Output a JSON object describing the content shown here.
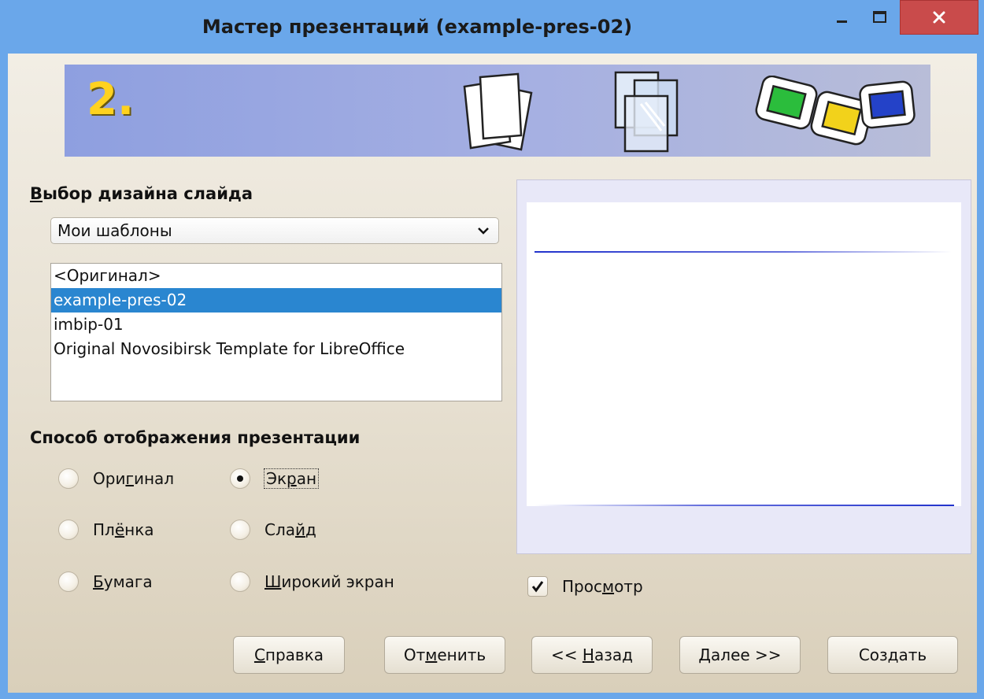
{
  "window": {
    "title": "Мастер презентаций (example-pres-02)"
  },
  "banner": {
    "step_number": "2."
  },
  "slide_design": {
    "heading_first": "В",
    "heading_rest": "ыбор дизайна слайда",
    "category_value": "Мои шаблоны",
    "templates": [
      {
        "label": "<Оригинал>",
        "selected": false
      },
      {
        "label": "example-pres-02",
        "selected": true
      },
      {
        "label": "imbip-01",
        "selected": false
      },
      {
        "label": "Original Novosibirsk Template for LibreOffice",
        "selected": false
      }
    ]
  },
  "output_medium": {
    "heading": "Способ отображения презентации",
    "options": {
      "original": {
        "pre": "Ори",
        "u": "г",
        "post": "инал"
      },
      "screen": {
        "pre": "Эк",
        "u": "р",
        "post": "ан"
      },
      "film": {
        "pre": "Пл",
        "u": "ё",
        "post": "нка"
      },
      "slide": {
        "pre": "Сла",
        "u": "й",
        "post": "д"
      },
      "paper": {
        "pre": "",
        "u": "Б",
        "post": "умага"
      },
      "widescreen": {
        "pre": "",
        "u": "Ш",
        "post": "ирокий экран"
      }
    },
    "selected": "screen"
  },
  "preview": {
    "checkbox": {
      "pre": "Прос",
      "u": "м",
      "post": "отр"
    },
    "checked": true
  },
  "buttons": {
    "help": {
      "pre": "",
      "u": "С",
      "post": "правка"
    },
    "cancel": {
      "pre": "От",
      "u": "м",
      "post": "енить"
    },
    "back": {
      "pre": "<< ",
      "u": "Н",
      "post": "азад"
    },
    "next": {
      "pre": "",
      "u": "Д",
      "post": "алее >>"
    },
    "create": {
      "pre": "",
      "u": "",
      "post": "Создать"
    }
  },
  "colors": {
    "titlebar": "#6aa7ea",
    "close_button": "#c94b4b",
    "selection": "#2a86d0",
    "banner_number": "#ffd21f",
    "preview_line": "#2233cc"
  },
  "icons": {
    "minimize": "minimize-icon",
    "maximize": "maximize-icon",
    "close": "close-icon",
    "dropdown": "chevron-down-icon",
    "checkbox": "check-icon"
  }
}
